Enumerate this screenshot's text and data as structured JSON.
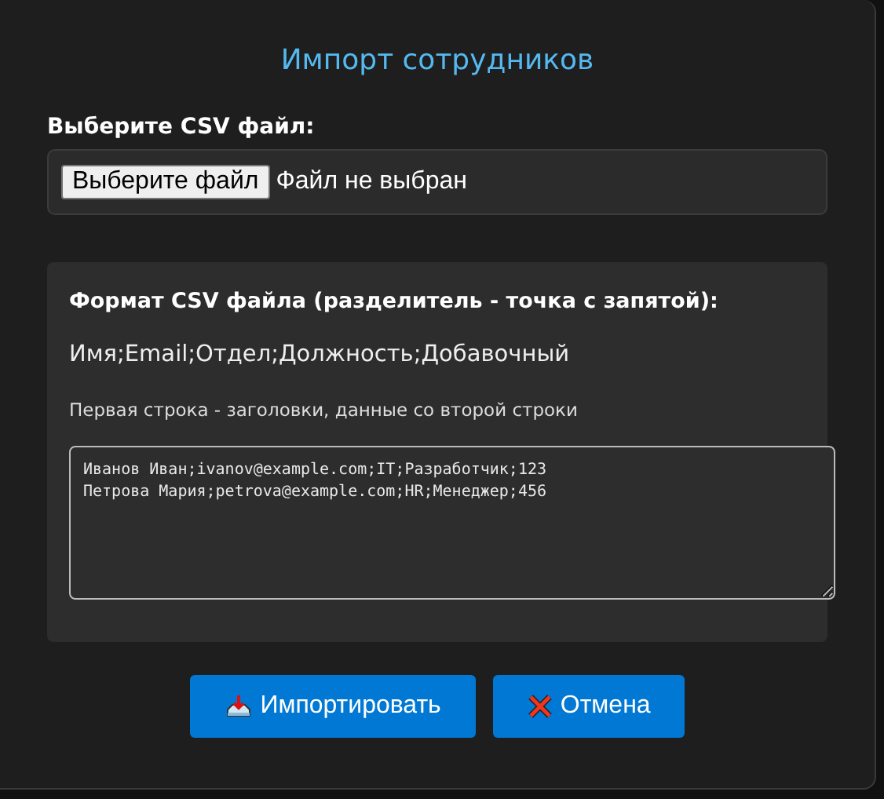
{
  "dialog": {
    "title": "Импорт сотрудников"
  },
  "file_picker": {
    "label": "Выберите CSV файл:",
    "button": "Выберите файл",
    "status": "Файл не выбран"
  },
  "format": {
    "heading": "Формат CSV файла (разделитель - точка с запятой):",
    "columns": "Имя;Email;Отдел;Должность;Добавочный",
    "note": "Первая строка - заголовки, данные со второй строки",
    "example": "Иванов Иван;ivanov@example.com;IT;Разработчик;123\nПетрова Мария;petrova@example.com;HR;Менеджер;456"
  },
  "buttons": [
    {
      "kind": "import",
      "label": "Импортировать"
    },
    {
      "kind": "cancel",
      "label": "Отмена"
    }
  ]
}
